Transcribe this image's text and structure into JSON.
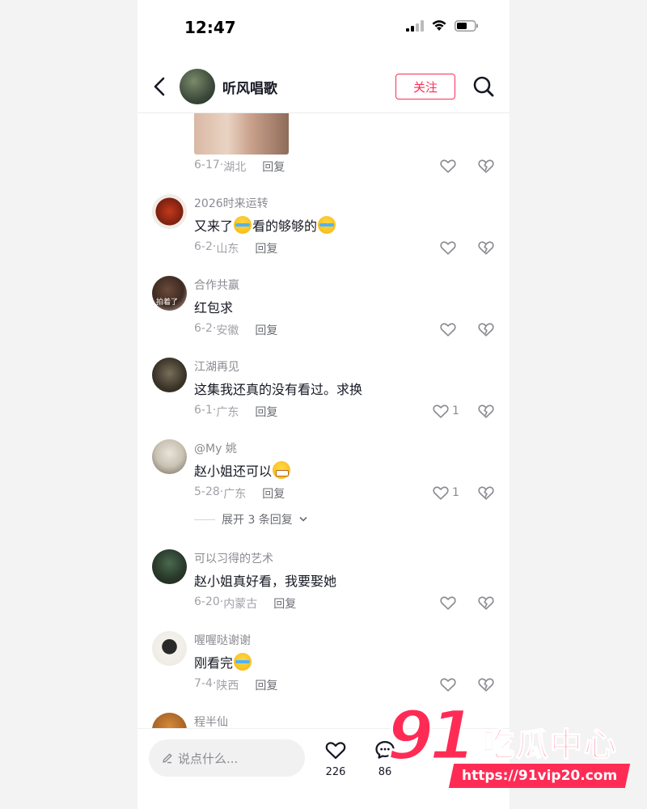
{
  "status_bar": {
    "time": "12:47"
  },
  "header": {
    "username": "听风唱歌",
    "follow_label": "关注"
  },
  "first_comment_meta": {
    "date": "6-17",
    "region": "湖北",
    "reply_label": "回复"
  },
  "comments": [
    {
      "username": "2026时来运转",
      "text": "又来了",
      "text_after": "看的够够的",
      "date": "6-2",
      "region": "山东",
      "reply_label": "回复",
      "likes": ""
    },
    {
      "username": "合作共赢",
      "text": "红包求",
      "date": "6-2",
      "region": "安徽",
      "reply_label": "回复",
      "likes": "",
      "avatar_text": "拍着了"
    },
    {
      "username": "江湖再见",
      "text": "这集我还真的没有看过。求换",
      "date": "6-1",
      "region": "广东",
      "reply_label": "回复",
      "likes": "1"
    },
    {
      "username": "@My 姚",
      "text": "赵小姐还可以",
      "date": "5-28",
      "region": "广东",
      "reply_label": "回复",
      "likes": "1",
      "expand_label": "展开 3 条回复"
    },
    {
      "username": "可以习得的艺术",
      "text": "赵小姐真好看，我要娶她",
      "date": "6-20",
      "region": "内蒙古",
      "reply_label": "回复",
      "likes": ""
    },
    {
      "username": "喔喔哒谢谢",
      "text": "刚看完",
      "date": "7-4",
      "region": "陕西",
      "reply_label": "回复",
      "likes": ""
    },
    {
      "username": "程半仙"
    }
  ],
  "bottom_bar": {
    "input_placeholder": "说点什么...",
    "like_count": "226",
    "comment_count": "86"
  },
  "watermark": {
    "number": "91",
    "brand": "吃瓜中心",
    "url": "https://91vip20.com"
  },
  "colors": {
    "accent": "#fe2c55",
    "secondary_text": "#8a8b91"
  }
}
